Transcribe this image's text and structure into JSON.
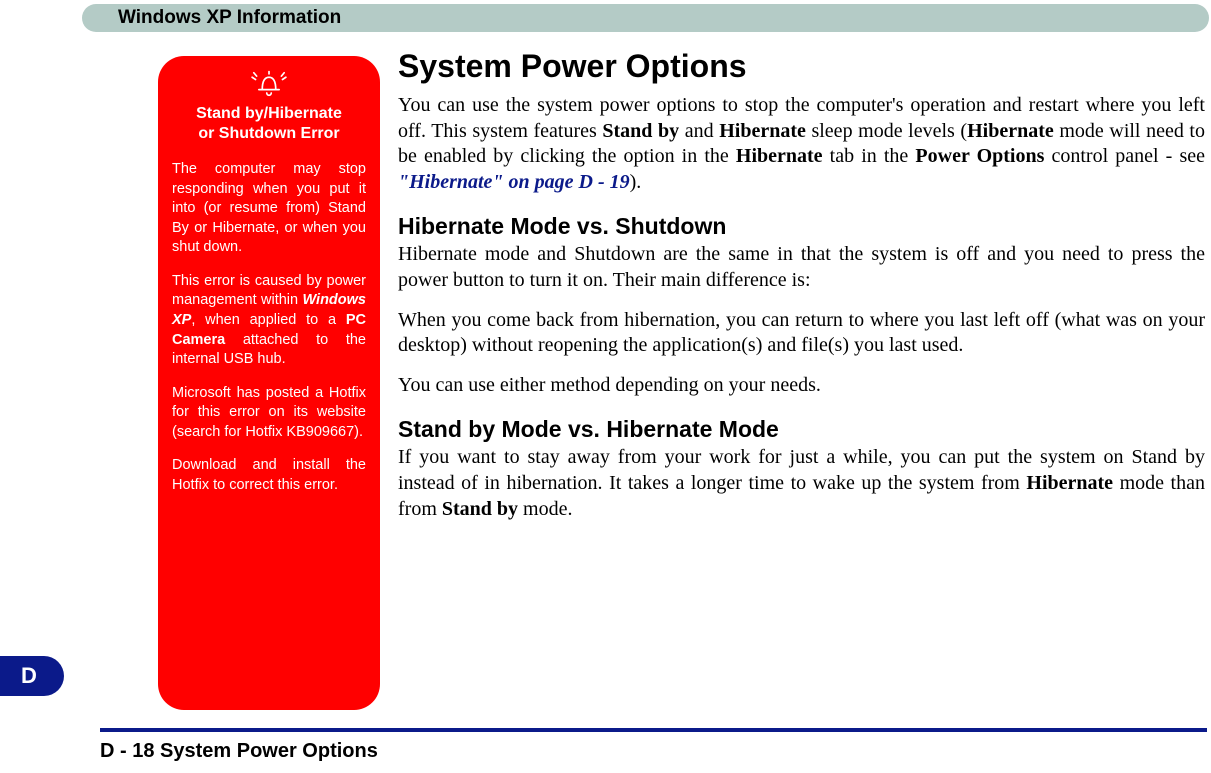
{
  "header": {
    "title": "Windows XP Information"
  },
  "side_tab": {
    "label": "D"
  },
  "warning": {
    "title_html": "Stand by/Hibernate<br>or Shutdown Error",
    "p1": "The computer may stop responding when you put it into (or resume from) Stand By or Hibernate, or when you shut down.",
    "p2_html": "This error is caused by power management within <span class=\"bi\">Windows XP</span>, when applied to a <span class=\"b\">PC Camera</span> attached to the internal USB hub.",
    "p3": "Microsoft has posted a Hotfix for this error on its website (search for Hotfix KB909667).",
    "p4": "Download and install the Hotfix to correct this error."
  },
  "content": {
    "h1": "System Power Options",
    "p1_html": "You can use the system power options to stop the computer's operation and restart where you left off. This system features <span class=\"b\">Stand by</span> and <span class=\"b\">Hibernate</span> sleep mode levels (<span class=\"b\">Hibernate</span> mode will need to be enabled by clicking the option in the <span class=\"b\">Hibernate</span> tab in the <span class=\"b\">Power Options</span> control panel - see <span class=\"link\">\"Hibernate\" on page D - 19</span>).",
    "h2a": "Hibernate Mode vs. Shutdown",
    "p2": "Hibernate mode and Shutdown are the same in that the system is off and you need to press the power button to turn it on. Their main difference is:",
    "p3": "When you come back from hibernation, you can return to where you last left off (what was on your desktop) without reopening the application(s) and file(s) you last used.",
    "p4": "You can use either method depending on your needs.",
    "h2b": "Stand by Mode vs. Hibernate Mode",
    "p5_html": "If you want to stay away from your work for just a while, you can put the system on Stand by instead of in hibernation. It takes a longer time to wake up the system from <span class=\"b\">Hibernate</span> mode than from <span class=\"b\">Stand by</span> mode."
  },
  "footer": {
    "text": "D - 18 System Power Options"
  }
}
